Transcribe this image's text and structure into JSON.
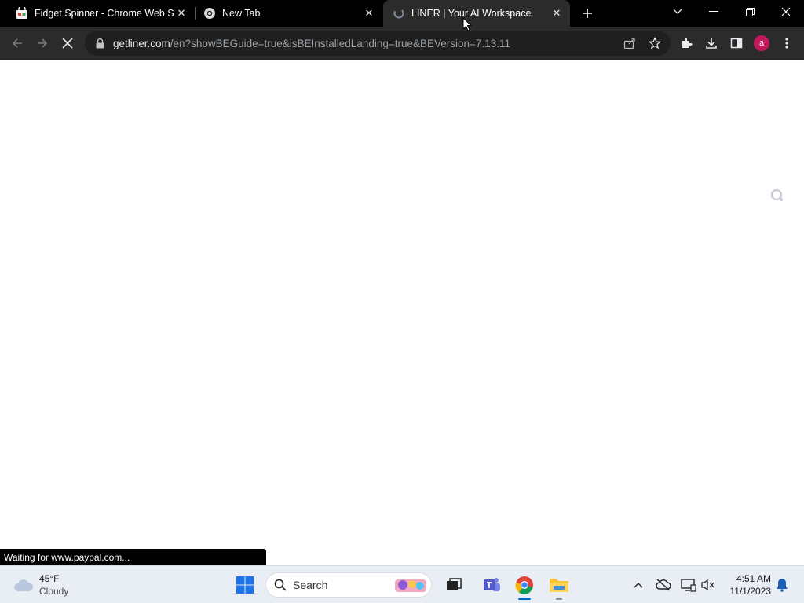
{
  "browser": {
    "tabs": [
      {
        "title": "Fidget Spinner - Chrome Web St",
        "icon": "web-store-icon",
        "active": false
      },
      {
        "title": "New Tab",
        "icon": "chrome-icon",
        "active": false
      },
      {
        "title": "LINER | Your AI Workspace",
        "icon": "liner-icon",
        "active": true
      }
    ],
    "address": {
      "host": "getliner.com",
      "path": "/en?showBEGuide=true&isBEInstalledLanding=true&BEVersion=7.13.11"
    },
    "profile_initial": "a",
    "status_text": "Waiting for www.paypal.com..."
  },
  "taskbar": {
    "weather": {
      "temp": "45°F",
      "condition": "Cloudy"
    },
    "search_label": "Search",
    "clock": {
      "time": "4:51 AM",
      "date": "11/1/2023"
    }
  },
  "colors": {
    "tabstrip": "#000000",
    "toolbar": "#2b2b2b",
    "avatar": "#c2185b",
    "taskbar": "#e9eef5"
  }
}
